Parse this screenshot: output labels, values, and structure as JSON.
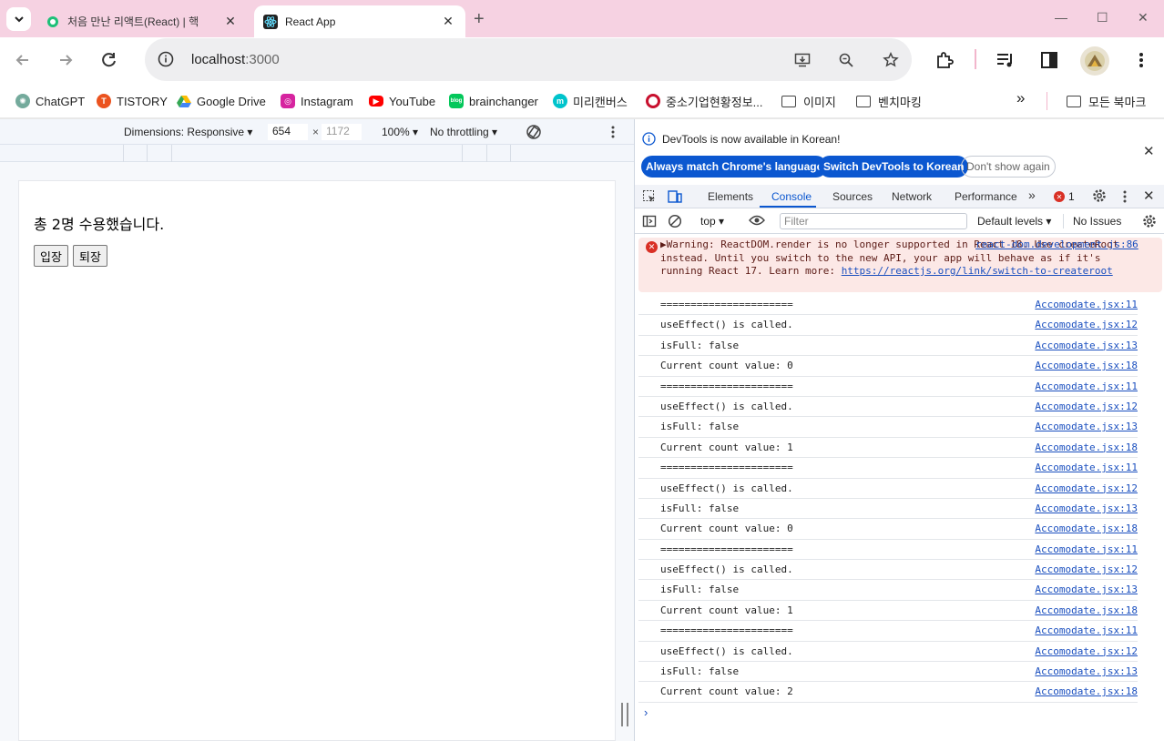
{
  "browser": {
    "tabs": [
      {
        "title": "처음 만난 리액트(React) | 핵",
        "active": false,
        "favicon": "course-icon"
      },
      {
        "title": "React App",
        "active": true,
        "favicon": "react-icon"
      }
    ],
    "new_tab": "+",
    "url_host": "localhost",
    "url_port": ":3000"
  },
  "bookmarks": [
    {
      "label": "ChatGPT",
      "icon": "chatgpt-icon",
      "color": "#74aa9c"
    },
    {
      "label": "TISTORY",
      "icon": "tistory-icon",
      "color": "#eb531f"
    },
    {
      "label": "Google Drive",
      "icon": "drive-icon",
      "color": "#34a853"
    },
    {
      "label": "Instagram",
      "icon": "instagram-icon",
      "color": "#d6249f"
    },
    {
      "label": "YouTube",
      "icon": "youtube-icon",
      "color": "#ff0000"
    },
    {
      "label": "brainchanger",
      "icon": "blog-icon",
      "color": "#03c75a"
    },
    {
      "label": "미리캔버스",
      "icon": "miricanvas-icon",
      "color": "#00c4cc"
    },
    {
      "label": "중소기업현황정보...",
      "icon": "sme-icon",
      "color": "#c8102e"
    },
    {
      "label": "이미지",
      "icon": "folder-icon",
      "color": "#444444"
    },
    {
      "label": "벤치마킹",
      "icon": "folder-icon",
      "color": "#444444"
    }
  ],
  "bookmarks_more": "»",
  "all_bookmarks": "모든 북마크",
  "device_toolbar": {
    "dimensions": "Dimensions: Responsive",
    "width": "654",
    "height": "1172",
    "times": "×",
    "zoom": "100%",
    "throttling": "No throttling"
  },
  "app": {
    "message": "총 2명 수용했습니다.",
    "enter_button": "입장",
    "exit_button": "퇴장"
  },
  "devtools": {
    "banner_text": "DevTools is now available in Korean!",
    "btn_match": "Always match Chrome's language",
    "btn_switch": "Switch DevTools to Korean",
    "btn_dont_show": "Don't show again",
    "tabs": [
      "Elements",
      "Console",
      "Sources",
      "Network",
      "Performance"
    ],
    "active_tab": "Console",
    "error_count": "1",
    "context": "top",
    "filter_placeholder": "Filter",
    "levels": "Default levels",
    "issues": "No Issues",
    "accent": "#0b57d0"
  },
  "console": {
    "warning": {
      "text": "Warning: ReactDOM.render is no longer supported in React 18. Use createRoot instead. Until you switch to the new API, your app will behave as if it's running React 17. Learn more: ",
      "link": "https://reactjs.org/link/switch-to-createroot",
      "source": "react-dom.development.js:86"
    },
    "logs": [
      {
        "msg": "======================",
        "src": "Accomodate.jsx:11"
      },
      {
        "msg": "useEffect() is called.",
        "src": "Accomodate.jsx:12"
      },
      {
        "msg": "isFull: false",
        "src": "Accomodate.jsx:13"
      },
      {
        "msg": "Current count value: 0",
        "src": "Accomodate.jsx:18"
      },
      {
        "msg": "======================",
        "src": "Accomodate.jsx:11"
      },
      {
        "msg": "useEffect() is called.",
        "src": "Accomodate.jsx:12"
      },
      {
        "msg": "isFull: false",
        "src": "Accomodate.jsx:13"
      },
      {
        "msg": "Current count value: 1",
        "src": "Accomodate.jsx:18"
      },
      {
        "msg": "======================",
        "src": "Accomodate.jsx:11"
      },
      {
        "msg": "useEffect() is called.",
        "src": "Accomodate.jsx:12"
      },
      {
        "msg": "isFull: false",
        "src": "Accomodate.jsx:13"
      },
      {
        "msg": "Current count value: 0",
        "src": "Accomodate.jsx:18"
      },
      {
        "msg": "======================",
        "src": "Accomodate.jsx:11"
      },
      {
        "msg": "useEffect() is called.",
        "src": "Accomodate.jsx:12"
      },
      {
        "msg": "isFull: false",
        "src": "Accomodate.jsx:13"
      },
      {
        "msg": "Current count value: 1",
        "src": "Accomodate.jsx:18"
      },
      {
        "msg": "======================",
        "src": "Accomodate.jsx:11"
      },
      {
        "msg": "useEffect() is called.",
        "src": "Accomodate.jsx:12"
      },
      {
        "msg": "isFull: false",
        "src": "Accomodate.jsx:13"
      },
      {
        "msg": "Current count value: 2",
        "src": "Accomodate.jsx:18"
      }
    ],
    "prompt": "›"
  }
}
